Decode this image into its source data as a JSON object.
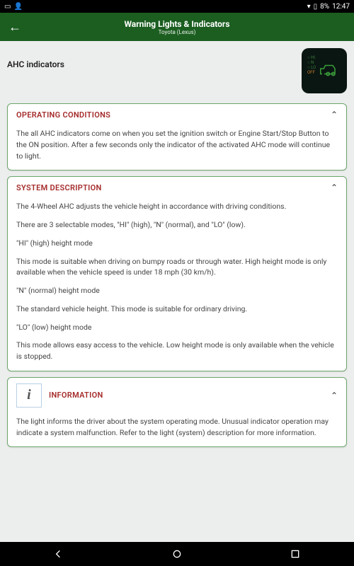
{
  "status": {
    "battery_text": "8%",
    "time": "12:47"
  },
  "header": {
    "title": "Warning Lights & Indicators",
    "subtitle": "Toyota (Lexus)"
  },
  "page": {
    "heading": "AHC indicators"
  },
  "panels": {
    "operating": {
      "title": "OPERATING CONDITIONS",
      "body": "The all AHC indicators come on when you set the ignition switch or Engine Start/Stop Button to the ON position. After a few seconds only the indicator of the activated AHC mode will continue to light."
    },
    "system": {
      "title": "SYSTEM DESCRIPTION",
      "p1": "The 4-Wheel AHC adjusts the vehicle height in accordance with driving conditions.",
      "p2": "There are 3 selectable modes, \"HI\" (high), \"N\" (normal), and \"LO\" (low).",
      "p3": "\"HI\" (high) height mode",
      "p4": "This mode is suitable when driving on bumpy roads or through water. High height mode is only available when the vehicle speed is under 18 mph (30 km/h).",
      "p5": "\"N\" (normal) height mode",
      "p6": "The standard vehicle height. This mode is suitable for ordinary driving.",
      "p7": "\"LO\" (low) height mode",
      "p8": "This mode allows easy access to the vehicle. Low height mode is only available when the vehicle is stopped."
    },
    "information": {
      "title": "INFORMATION",
      "body": "The light informs the driver about the system operating mode. Unusual indicator operation may indicate a system malfunction. Refer to the light (system) description for more information."
    }
  },
  "icon_levels": {
    "hi": "○ HI",
    "n": "○ N",
    "lo": "○ LO",
    "off": "OFF"
  }
}
